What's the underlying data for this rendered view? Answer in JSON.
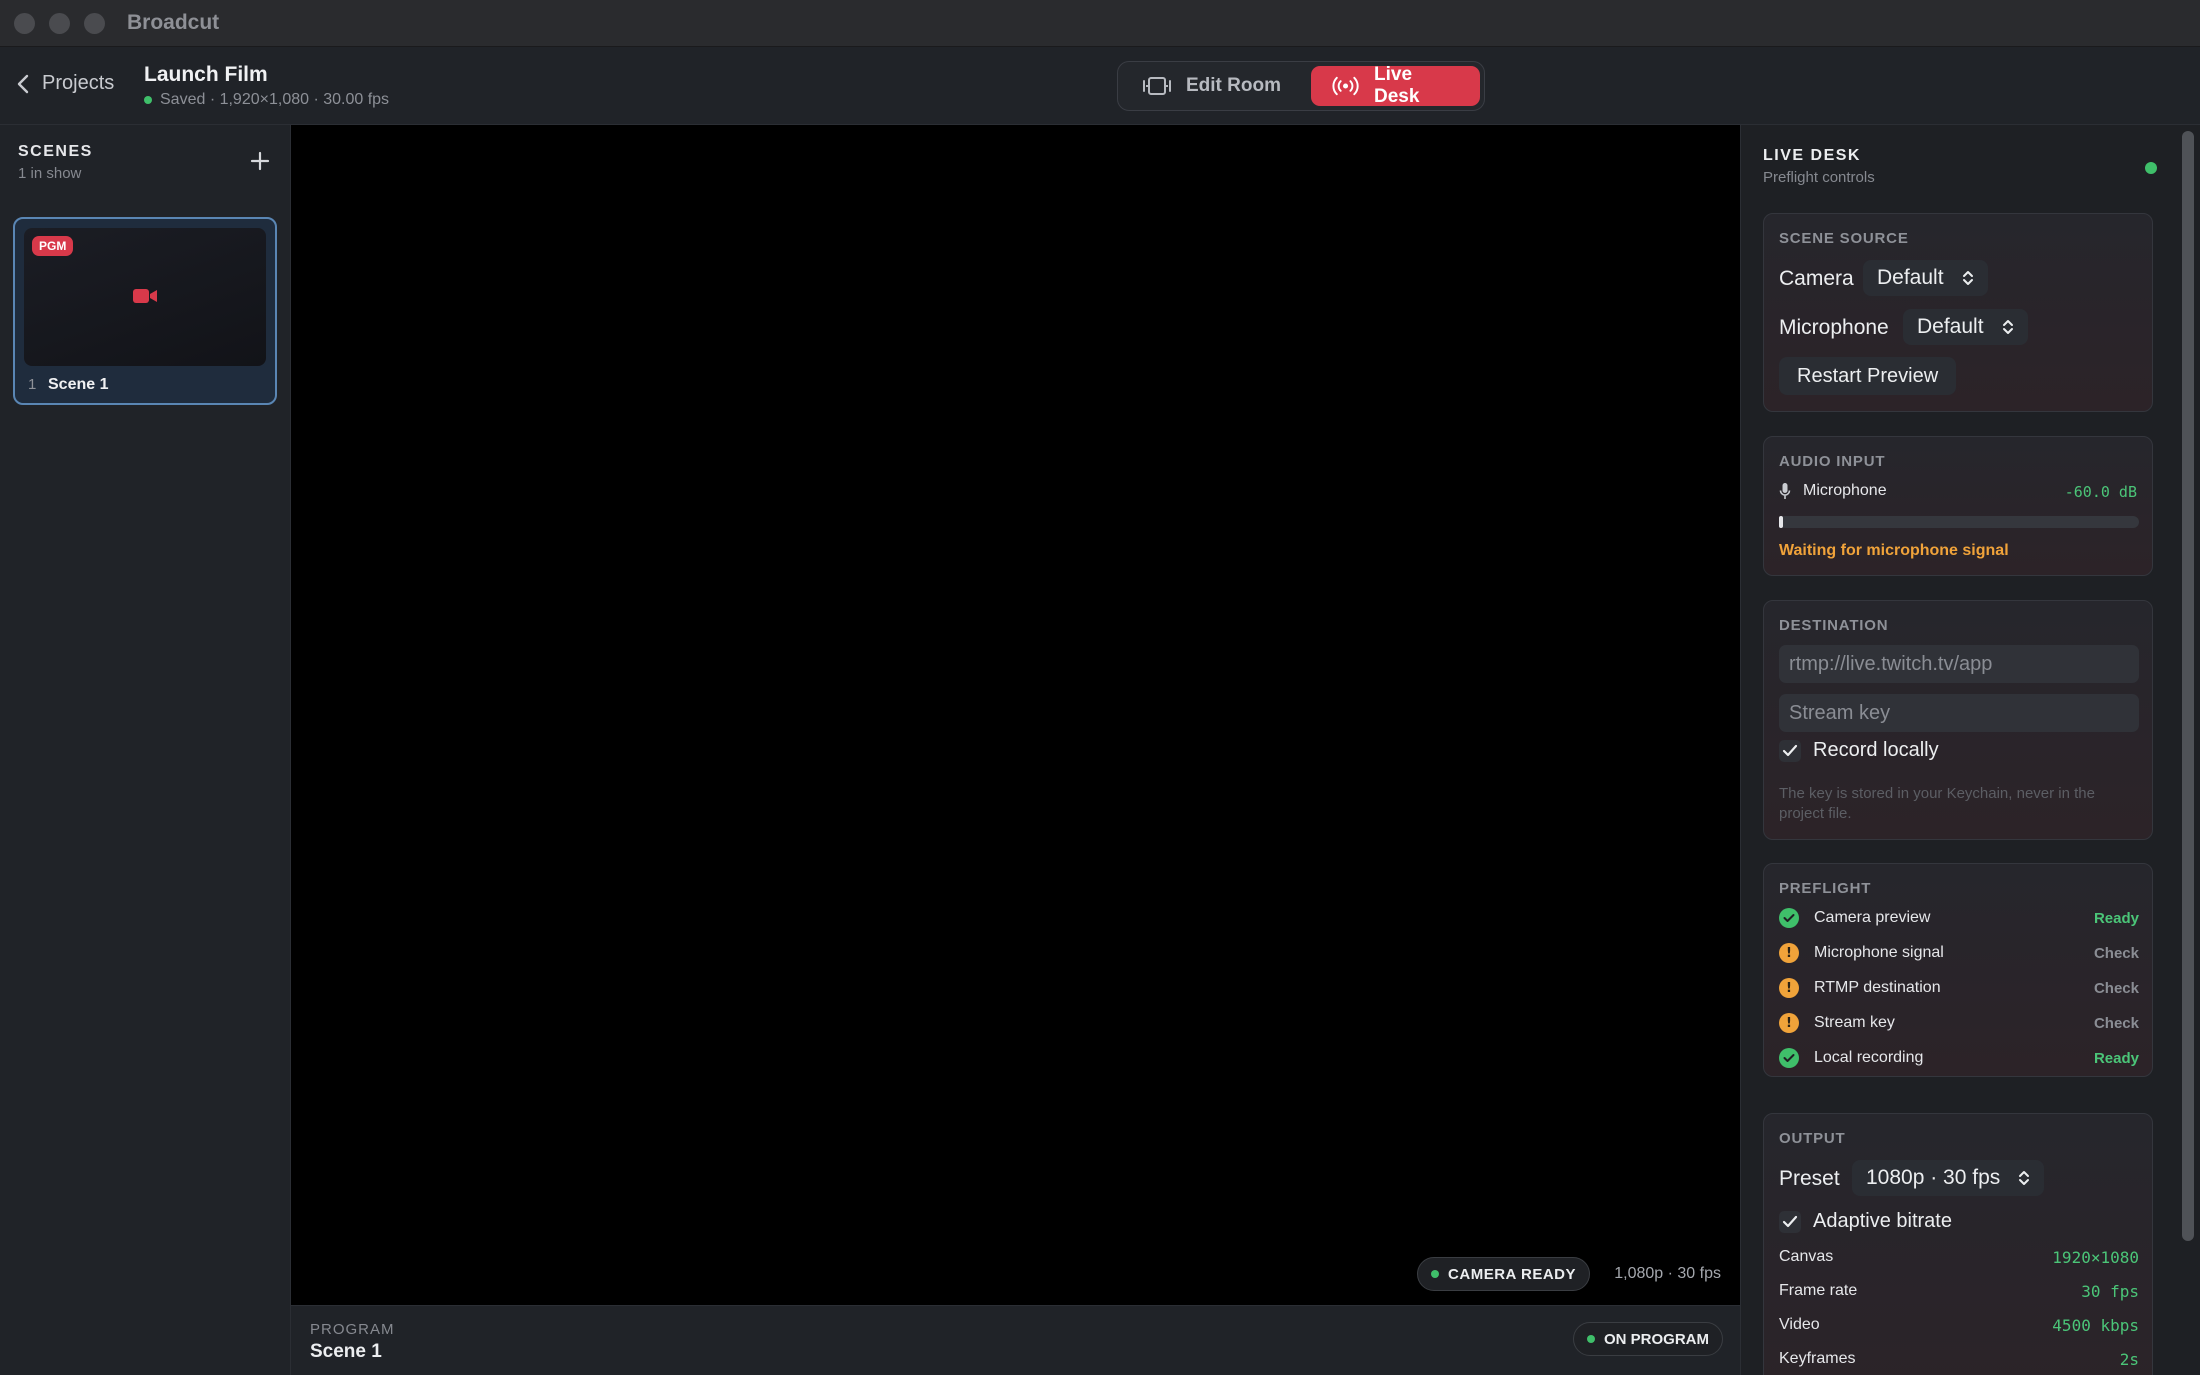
{
  "app": {
    "title": "Broadcut"
  },
  "header": {
    "back_label": "Projects",
    "project_title": "Launch Film",
    "project_meta": "Saved · 1,920×1,080 · 30.00 fps",
    "modes": [
      {
        "label": "Edit Room",
        "active": false
      },
      {
        "label": "Live Desk",
        "active": true
      }
    ]
  },
  "sidebar": {
    "heading": "SCENES",
    "subheading": "1 in show",
    "scenes": [
      {
        "number": "1",
        "name": "Scene 1",
        "badge": "PGM"
      }
    ]
  },
  "preview": {
    "status_badge": "CAMERA READY",
    "resolution": "1,080p · 30 fps"
  },
  "program": {
    "label": "PROGRAM",
    "scene": "Scene 1",
    "badge": "ON PROGRAM"
  },
  "live_desk": {
    "title": "LIVE DESK",
    "subtitle": "Preflight controls",
    "scene_source": {
      "heading": "SCENE SOURCE",
      "camera_label": "Camera",
      "camera_value": "Default",
      "microphone_label": "Microphone",
      "microphone_value": "Default",
      "restart_label": "Restart Preview"
    },
    "audio_input": {
      "heading": "AUDIO INPUT",
      "device": "Microphone",
      "level": "-60.0 dB",
      "level_fraction": 0.01,
      "status": "Waiting for microphone signal"
    },
    "destination": {
      "heading": "DESTINATION",
      "url_placeholder": "rtmp://live.twitch.tv/app",
      "key_placeholder": "Stream key",
      "record_label": "Record locally",
      "record_checked": true,
      "hint": "The key is stored in your Keychain, never in the project file."
    },
    "preflight": {
      "heading": "PREFLIGHT",
      "items": [
        {
          "name": "Camera preview",
          "state": "Ready",
          "ok": true
        },
        {
          "name": "Microphone signal",
          "state": "Check",
          "ok": false
        },
        {
          "name": "RTMP destination",
          "state": "Check",
          "ok": false
        },
        {
          "name": "Stream key",
          "state": "Check",
          "ok": false
        },
        {
          "name": "Local recording",
          "state": "Ready",
          "ok": true
        }
      ]
    },
    "output": {
      "heading": "OUTPUT",
      "preset_label": "Preset",
      "preset_value": "1080p · 30 fps",
      "adaptive_label": "Adaptive bitrate",
      "adaptive_checked": true,
      "stats": [
        {
          "key": "Canvas",
          "value": "1920×1080"
        },
        {
          "key": "Frame rate",
          "value": "30 fps"
        },
        {
          "key": "Video",
          "value": "4500 kbps"
        },
        {
          "key": "Keyframes",
          "value": "2s"
        }
      ]
    }
  },
  "colors": {
    "accent_live": "#d8394a",
    "status_ok": "#3fbf6a",
    "status_warn": "#f0a33a"
  },
  "icons": {
    "back": "chevron-left-icon",
    "edit_mode": "film-icon",
    "live_mode": "broadcast-icon",
    "add_scene": "plus-icon",
    "scene_camera": "video-camera-icon",
    "select": "updown-chevron-icon",
    "audio": "microphone-icon",
    "check": "checkmark-icon",
    "warning": "exclamation-icon"
  }
}
